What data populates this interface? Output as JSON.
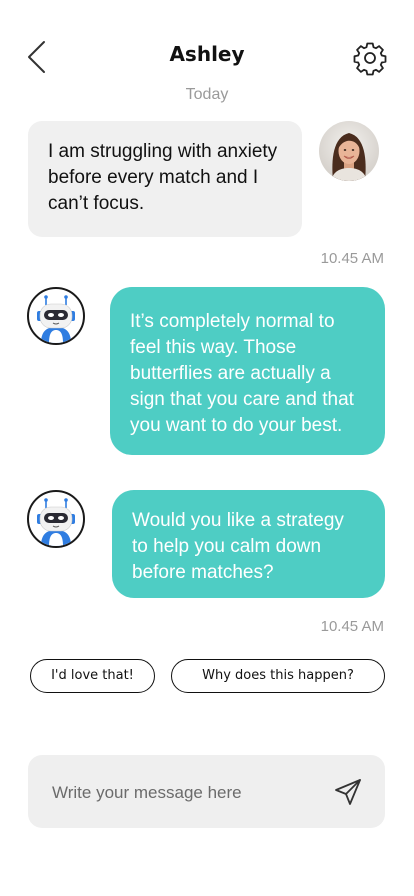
{
  "header": {
    "title": "Ashley",
    "back_icon": "chevron-left-icon",
    "settings_icon": "gear-icon"
  },
  "date_separator": "Today",
  "messages": [
    {
      "sender": "user",
      "text": "I am struggling with anxiety before every match and I can’t focus.",
      "avatar": "user-photo-avatar"
    },
    {
      "sender": "bot",
      "text": "It’s completely normal to feel this way. Those butterflies are actually a sign that you care and that you want to do your best.",
      "avatar": "robot-avatar"
    },
    {
      "sender": "bot",
      "text": "Would you like a strategy to help you calm down before matches?",
      "avatar": "robot-avatar"
    }
  ],
  "timestamps": [
    "10.45 AM",
    "10.45 AM"
  ],
  "quick_replies": [
    "I'd love that!",
    "Why does this happen?"
  ],
  "composer": {
    "placeholder": "Write your message here",
    "value": "",
    "send_icon": "send-icon"
  },
  "colors": {
    "bot_bubble": "#4ecdc4",
    "user_bubble": "#f0f0f0",
    "composer_bg": "#efefef",
    "muted_text": "#9a9a9a",
    "robot_blue": "#2f7de1"
  }
}
